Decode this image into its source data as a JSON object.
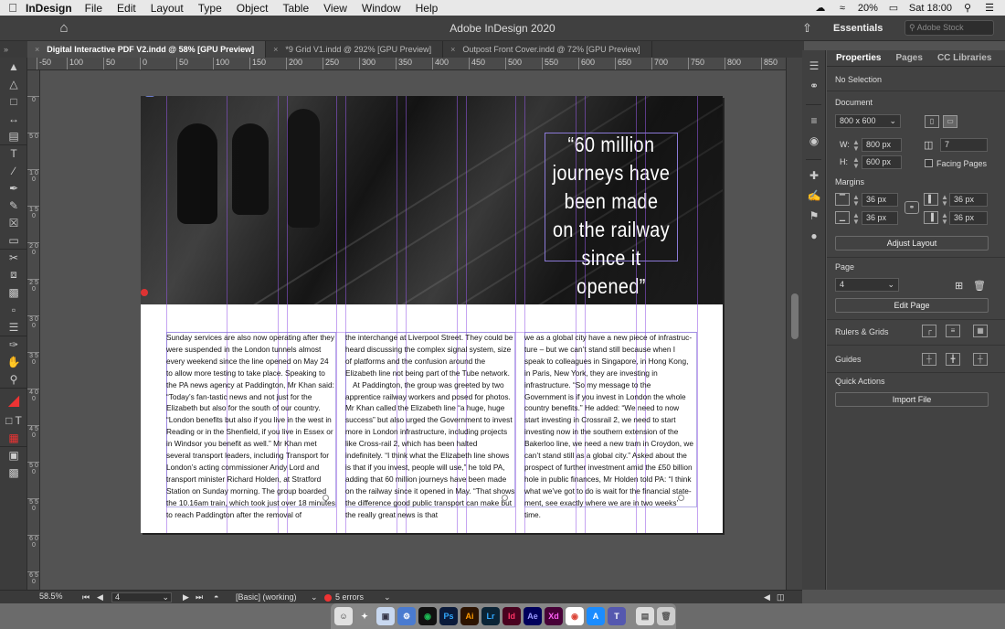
{
  "menubar": {
    "app": "InDesign",
    "items": [
      "File",
      "Edit",
      "Layout",
      "Type",
      "Object",
      "Table",
      "View",
      "Window",
      "Help"
    ],
    "battery": "20%",
    "clock": "Sat 18:00"
  },
  "appbar": {
    "title": "Adobe InDesign 2020",
    "workspace": "Essentials",
    "stock_placeholder": "Adobe Stock"
  },
  "tabs": [
    {
      "label": "Digital Interactive PDF V2.indd @ 58% [GPU Preview]",
      "active": true
    },
    {
      "label": "*9 Grid V1.indd @ 292% [GPU Preview]",
      "active": false
    },
    {
      "label": "Outpost Front Cover.indd @ 72% [GPU Preview]",
      "active": false
    }
  ],
  "ruler": {
    "h_labels": [
      "-50",
      "100",
      "50",
      "0",
      "50",
      "100",
      "150",
      "200",
      "250",
      "300",
      "350",
      "400",
      "450",
      "500",
      "550",
      "600",
      "650",
      "700",
      "750",
      "800",
      "850"
    ],
    "v_labels": [
      "0",
      "5 0",
      "1 0 0",
      "1 5 0",
      "2 0 0",
      "2 5 0",
      "3 0 0",
      "3 5 0",
      "4 0 0",
      "4 5 0",
      "5 0 0",
      "5 5 0",
      "6 0 0",
      "6 5 0"
    ]
  },
  "document": {
    "quote": "“60 million journeys have been made on the railway since it opened”",
    "col1": [
      "Sunday services are also now operating after they were suspended in the London tunnels almost every weekend since the line opened on May 24 to allow more testing to take place. Speaking to the PA news agency at Paddington, Mr Khan said: “Today’s fan-tastic news and not just for the Elizabeth but also for the south of our country. “London benefits but also if you live in the west in Reading or in the Shenfield, if you live in Essex or in Windsor you benefit as well.” Mr Khan met several transport leaders, including Transport for London’s acting commissioner Andy Lord and transport minister Richard Holden, at Stratford Station on Sunday morning. The group boarded the 10.16am train, which took just over 18 minutes to reach Paddington after the removal of"
    ],
    "col2": [
      "the interchange at Liverpool Street. They could be heard discussing the complex signal system, size of platforms and the confusion around the Elizabeth line not being part of the Tube network.",
      "At Paddington, the group was greeted by two apprentice railway workers and posed for photos. Mr Khan called the Elizabeth line “a huge, huge success” but also urged the Government to invest more in London infrastructure, including projects like Cross-rail 2, which has been halted indefinitely. “I think what the Elizabeth line shows is that if you invest, people will use,” he told PA, adding that 60 million journeys have been made on the railway since it opened in May. “That shows the difference good public transport can make but the really great news is that"
    ],
    "col3": [
      "we as a global city have a new piece of infrastruc-ture – but we can’t stand still because when I speak to colleagues in Singapore, in Hong Kong, in Paris, New York, they are investing in infrastructure. “So my message to the Government is if you invest in London the whole country benefits.” He added: “We need to now start investing in Crossrail 2, we need to start investing now in the southern extension of the Bakerloo line, we need a new tram in Croydon, we can’t stand still as a global city.” Asked about the prospect of further investment amid the £50 billion hole in public finances, Mr Holden told PA: “I think what we’ve got to do is wait for the financial state-ment, see exactly where we are in two weeks’ time."
    ]
  },
  "panel": {
    "tabs": [
      "Properties",
      "Pages",
      "CC Libraries"
    ],
    "selection": "No Selection",
    "document_label": "Document",
    "preset": "800 x 600",
    "w_label": "W:",
    "w_value": "800 px",
    "h_label": "H:",
    "h_value": "600 px",
    "pages_value": "7",
    "facing_pages": "Facing Pages",
    "margins_label": "Margins",
    "margin_top": "36 px",
    "margin_bottom": "36 px",
    "margin_left": "36 px",
    "margin_right": "36 px",
    "adjust_layout": "Adjust Layout",
    "page_label": "Page",
    "page_value": "4",
    "edit_page": "Edit Page",
    "rulers_grids": "Rulers & Grids",
    "guides": "Guides",
    "quick_actions": "Quick Actions",
    "import_file": "Import File"
  },
  "status": {
    "zoom": "58.5%",
    "page": "4",
    "profile": "[Basic] (working)",
    "errors": "5 errors"
  },
  "dock": [
    {
      "label": "Ps",
      "color": "#0a1a3a"
    },
    {
      "label": "Ai",
      "color": "#2c1300"
    },
    {
      "label": "Lr",
      "color": "#0b2436"
    },
    {
      "label": "Id",
      "color": "#3a0a1c"
    },
    {
      "label": "Ae",
      "color": "#1a0a3a"
    },
    {
      "label": "Xd",
      "color": "#3a0036"
    }
  ]
}
